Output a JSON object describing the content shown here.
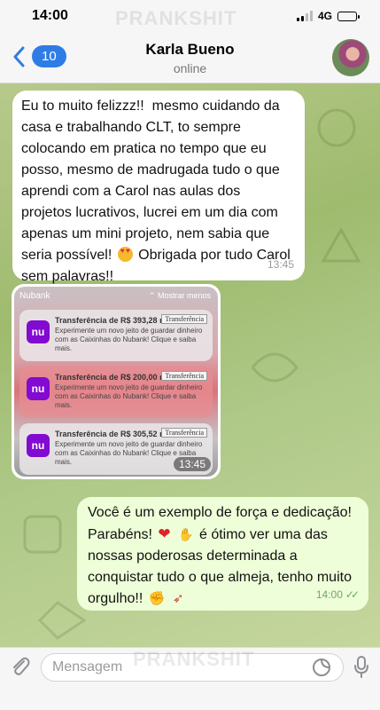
{
  "status_bar": {
    "time": "14:00",
    "network": "4G"
  },
  "watermark": "PRANKSHIT",
  "header": {
    "unread_count": "10",
    "contact_name": "Karla Bueno",
    "contact_status": "online"
  },
  "messages": [
    {
      "direction": "incoming",
      "text_a": "Eu to muito felizzz!!  mesmo cuidando da casa e trabalhando CLT, to sempre colocando em pratica no tempo que eu posso, mesmo de madrugada tudo o que aprendi com a ",
      "name_a": "Carol",
      "text_b": " nas aulas dos projetos lucrativos, lucrei em um dia com apenas um mini projeto, nem sabia que seria possível! ",
      "text_c": " Obrigada por tudo ",
      "name_b": "Carol",
      "text_d": " sem palavras!!",
      "time": "13:45"
    },
    {
      "direction": "incoming",
      "type": "photo",
      "photo_header": "Nubank",
      "photo_show_less": "Mostrar menos",
      "notifications": [
        {
          "title": "Transferência de R$ 393,28 r...",
          "tag": "Transferência",
          "body": "Experimente um novo jeito de guardar dinheiro com as Caixinhas do Nubank! Clique e saiba mais."
        },
        {
          "title": "Transferência de R$ 200,00 r...",
          "tag": "Transferência",
          "body": "Experimente um novo jeito de guardar dinheiro com as Caixinhas do Nubank! Clique e saiba mais."
        },
        {
          "title": "Transferência de R$ 305,52 re...",
          "tag": "Transferência",
          "body": "Experimente um novo jeito de guardar dinheiro com as Caixinhas do Nubank! Clique e saiba mais."
        }
      ],
      "logo_text": "nu",
      "time": "13:45"
    },
    {
      "direction": "outgoing",
      "text_a": "Você é um exemplo de força e dedicação! Parabéns! ",
      "text_b": " é ótimo ver uma das nossas poderosas determinada a conquistar tudo o que almeja, tenho muito orgulho!! ",
      "time": "14:00"
    }
  ],
  "input": {
    "placeholder": "Mensagem"
  },
  "icons": {
    "back": "chevron-left-icon",
    "attach": "paperclip-icon",
    "sticker": "sticker-icon",
    "mic": "microphone-icon"
  },
  "colors": {
    "accent": "#2f7ce6",
    "outgoing_bubble": "#eefed8",
    "nubank": "#820ad1"
  }
}
